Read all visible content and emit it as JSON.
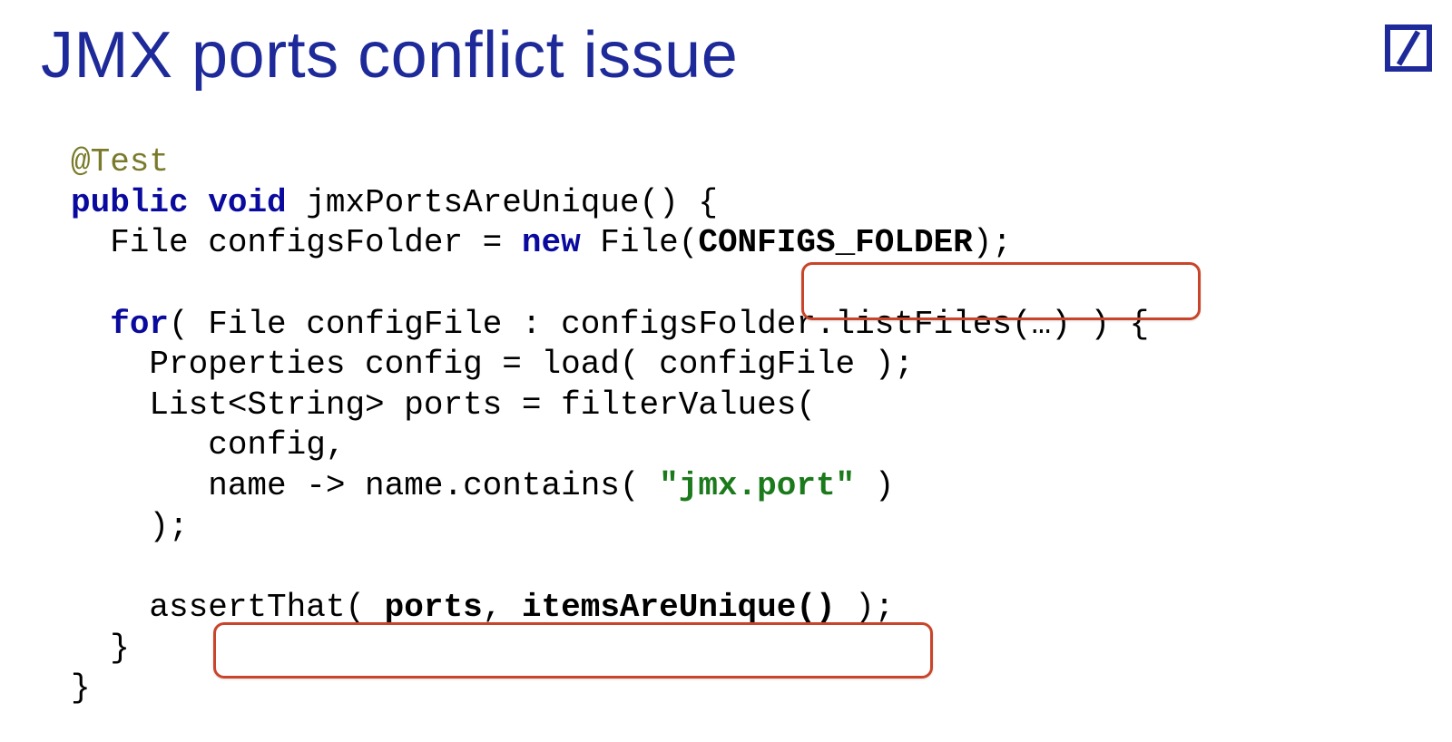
{
  "title": "JMX ports conflict issue",
  "code": {
    "annotation": "@Test",
    "kw_public": "public",
    "kw_void": "void",
    "methodSig": " jmxPortsAreUnique() {",
    "line2_pre": "  File configsFolder = ",
    "kw_new": "new",
    "line2_mid": " File",
    "line2_paren_open": "(",
    "configs_folder": "CONFIGS_FOLDER",
    "line2_paren_close": ");",
    "blank": "",
    "kw_for": "for",
    "line3_rest": "( File configFile : configsFolder.listFiles(…) ) {",
    "line4": "    Properties config = load( configFile );",
    "line5": "    List<String> ports = filterValues(",
    "line6": "       config,",
    "line7_pre": "       name -> name.contains( ",
    "string_jmx": "\"jmx.port\"",
    "line7_post": " )",
    "line8": "    );",
    "line9_pre": "    assertThat( ",
    "ports": "ports",
    "line9_mid": ", ",
    "itemsAreUnique": "itemsAreUnique()",
    "line9_post": " );",
    "line10": "  }",
    "line11": "}"
  }
}
